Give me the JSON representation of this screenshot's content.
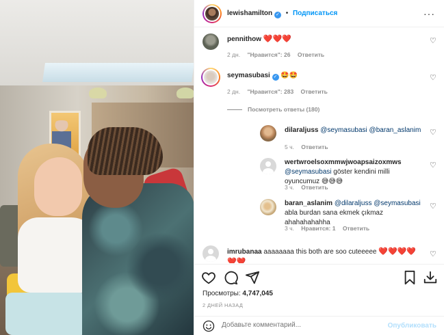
{
  "header": {
    "username": "lewishamilton",
    "follow_label": "Подписаться",
    "separator": "•",
    "more_label": "···"
  },
  "comments": [
    {
      "username": "pennithow",
      "text": "❤️❤️❤️",
      "age": "2 дн.",
      "likes": "\"Нравится\": 26",
      "reply_label": "Ответить"
    },
    {
      "username": "seymasubasi",
      "verified": true,
      "text": "🤩🤩",
      "age": "2 дн.",
      "likes": "\"Нравится\": 283",
      "reply_label": "Ответить",
      "view_replies": "Посмотреть ответы (180)"
    }
  ],
  "replies": [
    {
      "username": "dilaraljuss",
      "mention": "@seymasubasi",
      "mention2": "@baran_aslanim",
      "text": "",
      "age": "5 ч.",
      "reply_label": "Ответить"
    },
    {
      "username": "wertwroelsoxmmwjwoapsaizoxmws",
      "mention": "@seymasubasi",
      "text": "göster kendini milli oyuncumuz 😅😅😅",
      "age": "3 ч.",
      "reply_label": "Ответить"
    },
    {
      "username": "baran_aslanim",
      "mention": "@dilaraljuss",
      "mention2": "@seymasubasi",
      "text_line1": "abla",
      "text_line2": "burdan sana ekmek çıkmaz ahahahahahha",
      "age": "3 ч.",
      "likes": "Нравится: 1",
      "reply_label": "Ответить"
    }
  ],
  "last_comment": {
    "username": "imrubanaa",
    "text": "aaaaaaaa this both are soo cuteeeee",
    "hearts": "❤️❤️❤️❤️",
    "hearts_line2": "❤️❤️"
  },
  "stats": {
    "views_label": "Просмотры:",
    "views_value": "4,747,045",
    "posted_ago": "2 ДНЕЙ НАЗАД"
  },
  "composer": {
    "placeholder": "Добавьте комментарий...",
    "post_label": "Опубликовать"
  },
  "colors": {
    "link": "#0095f6",
    "mention": "#00376b",
    "muted": "#8e8e8e",
    "heart": "#e0245e"
  }
}
